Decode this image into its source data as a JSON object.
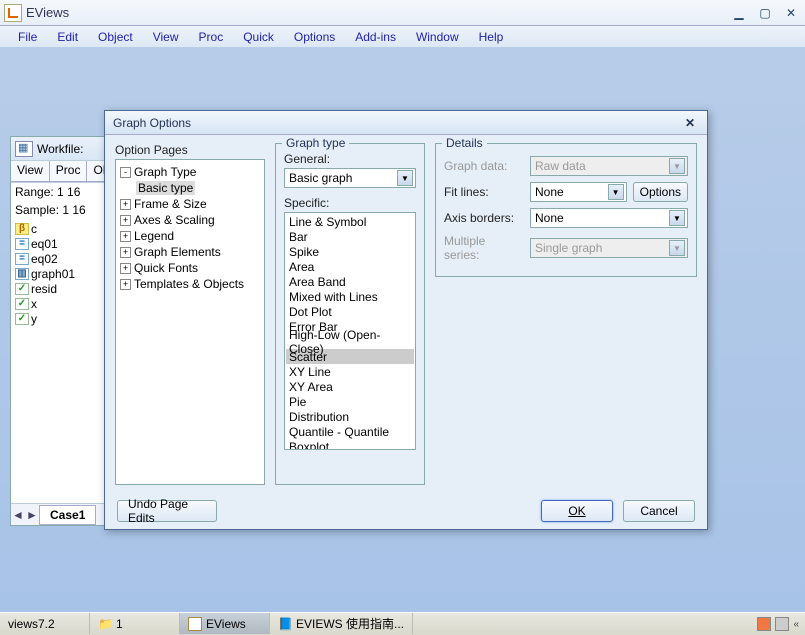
{
  "app": {
    "title": "EViews"
  },
  "menu": [
    "File",
    "Edit",
    "Object",
    "View",
    "Proc",
    "Quick",
    "Options",
    "Add-ins",
    "Window",
    "Help"
  ],
  "workfile": {
    "title": "Workfile:",
    "toolbar": [
      "View",
      "Proc",
      "Obj"
    ],
    "range": "Range: 1 16",
    "sample": "Sample: 1 16",
    "items": [
      {
        "icon": "beta",
        "label": "c"
      },
      {
        "icon": "eq",
        "label": "eq01"
      },
      {
        "icon": "eq",
        "label": "eq02"
      },
      {
        "icon": "graph",
        "label": "graph01"
      },
      {
        "icon": "chk",
        "label": "resid"
      },
      {
        "icon": "chk",
        "label": "x"
      },
      {
        "icon": "chk",
        "label": "y"
      }
    ],
    "tab": "Case1"
  },
  "dialog": {
    "title": "Graph Options",
    "option_pages_label": "Option Pages",
    "tree": [
      {
        "exp": "-",
        "label": "Graph Type",
        "children": [
          {
            "label": "Basic type",
            "selected": true
          }
        ]
      },
      {
        "exp": "+",
        "label": "Frame & Size"
      },
      {
        "exp": "+",
        "label": "Axes & Scaling"
      },
      {
        "exp": "+",
        "label": "Legend"
      },
      {
        "exp": "+",
        "label": "Graph Elements"
      },
      {
        "exp": "+",
        "label": "Quick Fonts"
      },
      {
        "exp": "+",
        "label": "Templates & Objects"
      }
    ],
    "graph_type": {
      "legend": "Graph type",
      "general_label": "General:",
      "general_value": "Basic graph",
      "specific_label": "Specific:",
      "specific_items": [
        "Line & Symbol",
        "Bar",
        "Spike",
        "Area",
        "Area Band",
        "Mixed with Lines",
        "Dot Plot",
        "Error Bar",
        "High-Low (Open-Close)",
        "Scatter",
        "XY Line",
        "XY Area",
        "Pie",
        "Distribution",
        "Quantile - Quantile",
        "Boxplot"
      ],
      "specific_selected": "Scatter"
    },
    "details": {
      "legend": "Details",
      "rows": [
        {
          "label": "Graph data:",
          "value": "Raw data",
          "disabled": true
        },
        {
          "label": "Fit lines:",
          "value": "None",
          "disabled": false,
          "button": "Options"
        },
        {
          "label": "Axis borders:",
          "value": "None",
          "disabled": false
        },
        {
          "label": "Multiple series:",
          "value": "Single graph",
          "disabled": true
        }
      ]
    },
    "undo_btn": "Undo Page Edits",
    "ok_btn": "OK",
    "cancel_btn": "Cancel"
  },
  "taskbar": {
    "items": [
      {
        "label": "views7.2",
        "type": "plain"
      },
      {
        "label": "1",
        "type": "folder"
      },
      {
        "label": "EViews",
        "type": "active"
      },
      {
        "label": "EVIEWS 使用指南...",
        "type": "doc"
      }
    ]
  }
}
